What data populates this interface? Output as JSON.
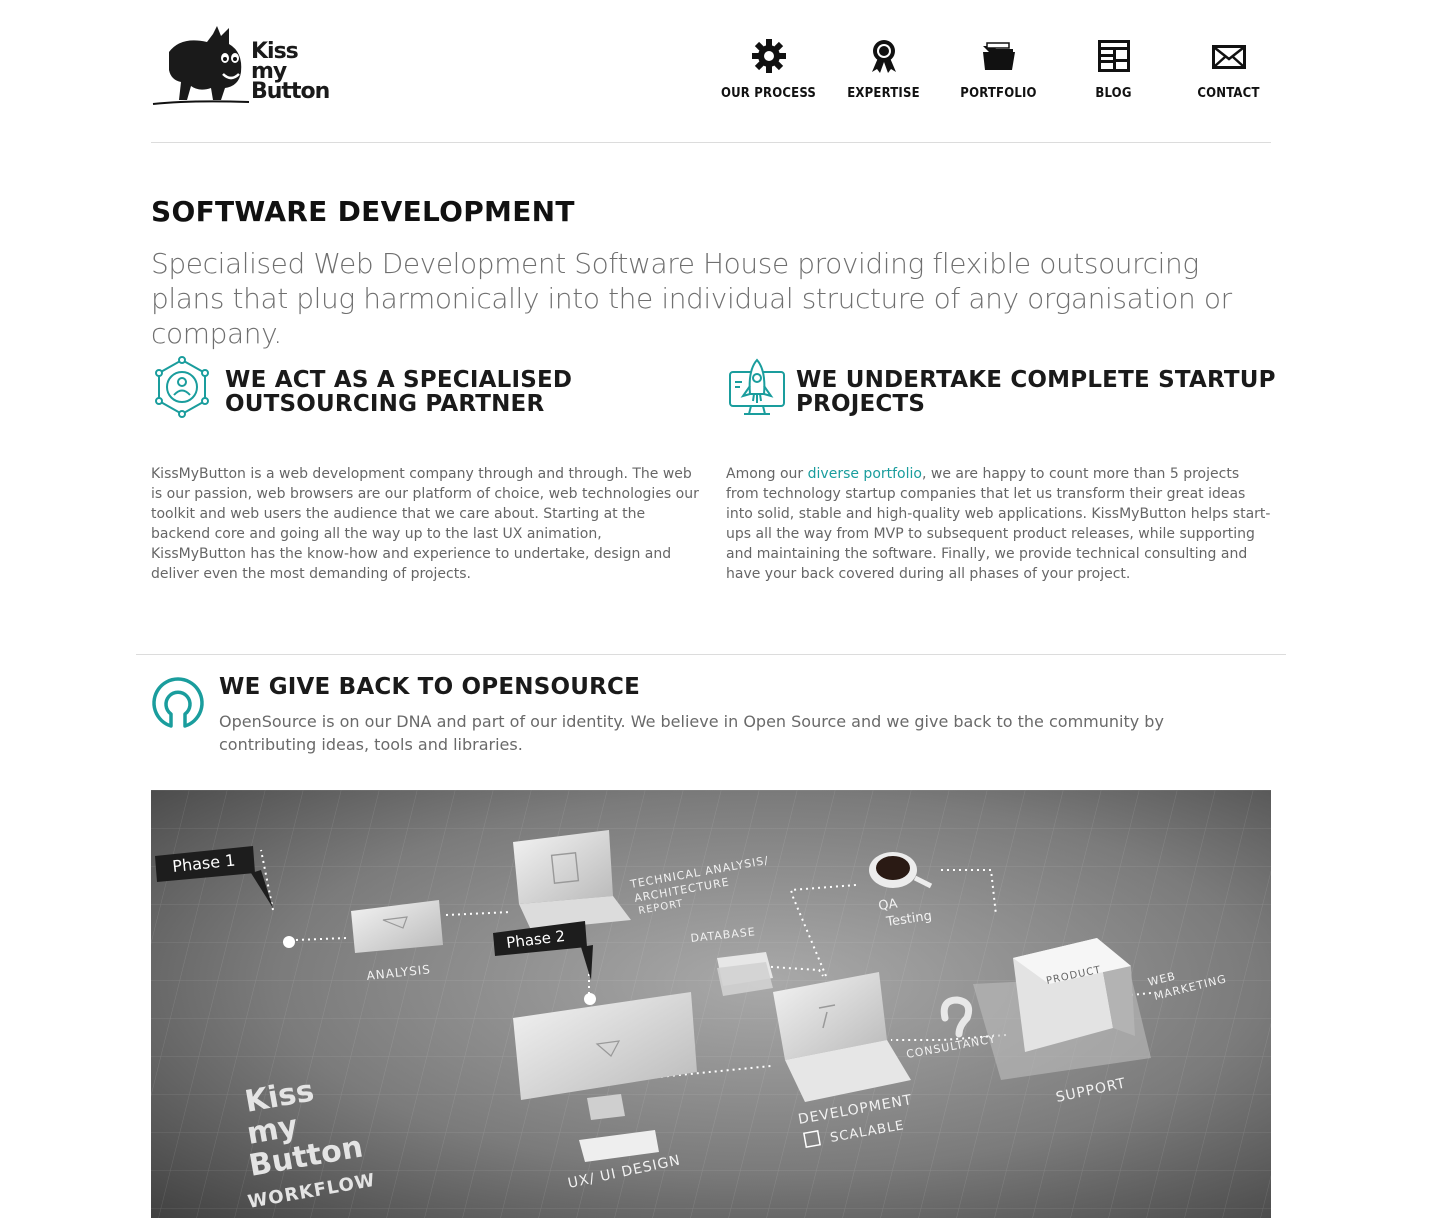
{
  "logo": {
    "line1": "Kiss",
    "line2": "my",
    "line3": "Button"
  },
  "nav": [
    {
      "label": "OUR PROCESS",
      "icon": "gear-icon"
    },
    {
      "label": "EXPERTISE",
      "icon": "award-ribbon-icon"
    },
    {
      "label": "PORTFOLIO",
      "icon": "folder-icon"
    },
    {
      "label": "BLOG",
      "icon": "blog-layout-icon"
    },
    {
      "label": "CONTACT",
      "icon": "envelope-icon"
    }
  ],
  "page": {
    "title": "SOFTWARE DEVELOPMENT",
    "intro": "Specialised Web Development Software House providing flexible outsourcing plans that plug harmonically into the individual structure of any organisation or company."
  },
  "features": [
    {
      "heading_line1": "WE ACT AS A SPECIALISED",
      "heading_line2": "OUTSOURCING PARTNER",
      "icon": "network-people-icon",
      "text": "KissMyButton is a web development company through and through. The web is our passion, web browsers are our platform of choice, web technologies our toolkit and web users the audience that we care about. Starting at the backend core and going all the way up to the last UX animation, KissMyButton has the know-how and experience to undertake, design and deliver even the most demanding of projects."
    },
    {
      "heading_line1": "WE UNDERTAKE COMPLETE STARTUP",
      "heading_line2": "PROJECTS",
      "icon": "rocket-monitor-icon",
      "text_before_link": "Among our ",
      "link": "diverse portfolio",
      "text_after_link": ", we are happy to count more than 5 projects from technology startup companies that let us transform their great ideas into solid, stable and high-quality web applications. KissMyButton helps start-ups all the way from MVP to subsequent product releases, while supporting and maintaining the software. Finally, we provide technical consulting and have your back covered during all phases of your project."
    }
  ],
  "opensource": {
    "heading": "WE GIVE BACK TO OPENSOURCE",
    "icon": "opensource-icon",
    "text": "OpenSource is on our DNA and part of our identity. We believe in Open Source and we give back to the community by contributing ideas, tools and libraries."
  },
  "workflow": {
    "phase1": "Phase 1",
    "phase2": "Phase 2",
    "analysis": "ANALYSIS",
    "tech_line1": "TECHNICAL ANALYSIS/",
    "tech_line2": "ARCHITECTURE",
    "tech_line3": "REPORT",
    "database": "DATABASE",
    "qa_line1": "QA",
    "qa_line2": "Testing",
    "product": "PRODUCT",
    "web_line1": "WEB",
    "web_line2": "MARKETING",
    "consultancy": "CONSULTANCY",
    "support": "SUPPORT",
    "development": "DEVELOPMENT",
    "scalable": "SCALABLE",
    "uxui": "UX/ UI DESIGN",
    "brand_line1": "Kiss",
    "brand_line2": "my",
    "brand_line3": "Button",
    "brand_line4": "WORKFLOW"
  },
  "colors": {
    "accent": "#1a9d9d",
    "heading": "#111111",
    "body": "#666666"
  }
}
